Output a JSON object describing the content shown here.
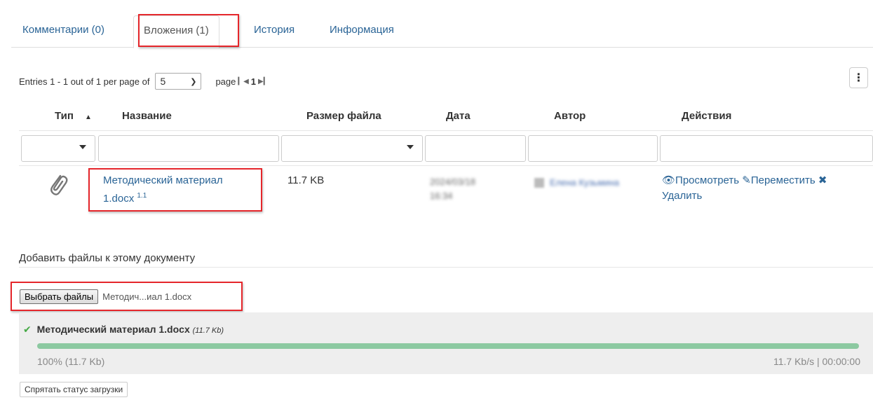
{
  "tabs": {
    "comments": "Комментарии (0)",
    "attachments": "Вложения (1)",
    "history": "История",
    "info": "Информация"
  },
  "list": {
    "entries_text": "Entries 1 - 1 out of 1 per page of",
    "per_page": "5",
    "page_label": "page",
    "page_first": "◀",
    "page_current": "1",
    "page_last": "▶"
  },
  "table": {
    "headers": {
      "type": "Тип",
      "name": "Название",
      "size": "Размер файла",
      "date": "Дата",
      "author": "Автор",
      "actions": "Действия"
    },
    "row": {
      "name_line1": "Методический материал",
      "name_line2": "1.docx",
      "version": "1.1",
      "size": "11.7 KB",
      "date_line1": "2024/03/18",
      "date_line2": "16:34",
      "author": "Елена Кузьмина",
      "action_view": "Просмотреть",
      "action_move": "Переместить",
      "action_delete": "Удалить"
    }
  },
  "upload": {
    "section_title": "Добавить файлы к этому документу",
    "choose_button": "Выбрать файлы",
    "chosen_file": "Методич...иал 1.docx",
    "status_file": "Методический материал 1.docx",
    "status_size": "(11.7 Kb)",
    "progress_percent": 100,
    "progress_text": "100% (11.7 Kb)",
    "speed_text": "11.7 Kb/s | 00:00:00",
    "hide_button": "Спрятать статус загрузки"
  },
  "colors": {
    "link": "#2a6496",
    "highlight": "#e5262b",
    "progress": "#8cc9a1",
    "check": "#45a945"
  }
}
